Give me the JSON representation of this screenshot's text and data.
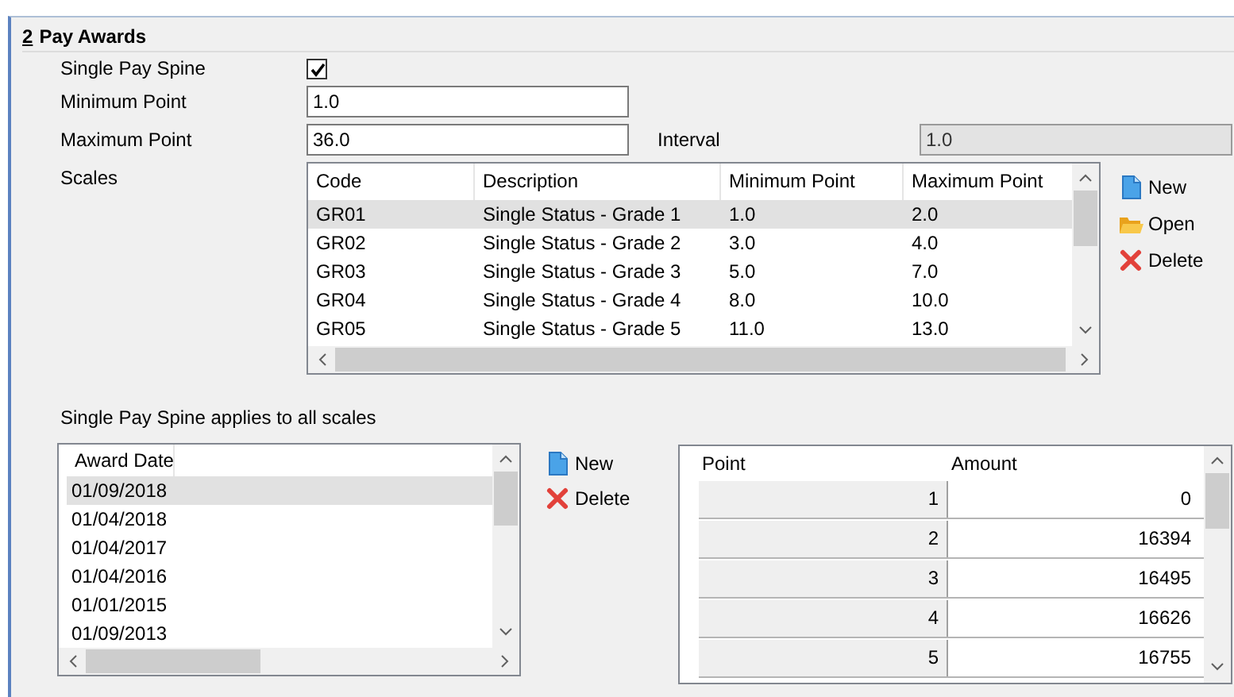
{
  "section": {
    "number": "2",
    "title": "Pay Awards"
  },
  "fields": [
    {
      "kind": "checkbox",
      "label": "Single Pay Spine",
      "checked": true
    },
    {
      "kind": "text",
      "label": "Minimum Point",
      "value": "1.0"
    },
    {
      "kind": "text",
      "label": "Maximum Point",
      "value": "36.0",
      "side": {
        "label": "Interval",
        "value": "1.0",
        "disabled": true
      }
    }
  ],
  "scales": {
    "label": "Scales",
    "columns": [
      "Code",
      "Description",
      "Minimum Point",
      "Maximum Point"
    ],
    "rows": [
      {
        "cells": [
          "GR01",
          "Single Status - Grade 1",
          "1.0",
          "2.0"
        ],
        "selected": true
      },
      {
        "cells": [
          "GR02",
          "Single Status - Grade 2",
          "3.0",
          "4.0"
        ],
        "selected": false
      },
      {
        "cells": [
          "GR03",
          "Single Status - Grade 3",
          "5.0",
          "7.0"
        ],
        "selected": false
      },
      {
        "cells": [
          "GR04",
          "Single Status - Grade 4",
          "8.0",
          "10.0"
        ],
        "selected": false
      },
      {
        "cells": [
          "GR05",
          "Single Status - Grade 5",
          "11.0",
          "13.0"
        ],
        "selected": false
      }
    ]
  },
  "scale_actions": [
    {
      "kind": "new",
      "label": "New"
    },
    {
      "kind": "open",
      "label": "Open"
    },
    {
      "kind": "delete",
      "label": "Delete"
    }
  ],
  "spine_note": "Single Pay Spine applies to all scales",
  "award_dates": {
    "column": "Award Date",
    "rows": [
      {
        "date": "01/09/2018",
        "selected": true
      },
      {
        "date": "01/04/2018",
        "selected": false
      },
      {
        "date": "01/04/2017",
        "selected": false
      },
      {
        "date": "01/04/2016",
        "selected": false
      },
      {
        "date": "01/01/2015",
        "selected": false
      },
      {
        "date": "01/09/2013",
        "selected": false
      }
    ]
  },
  "award_actions": [
    {
      "kind": "new",
      "label": "New"
    },
    {
      "kind": "delete",
      "label": "Delete"
    }
  ],
  "points": {
    "columns": [
      "Point",
      "Amount"
    ],
    "rows": [
      {
        "point": "1",
        "amount": "0"
      },
      {
        "point": "2",
        "amount": "16394"
      },
      {
        "point": "3",
        "amount": "16495"
      },
      {
        "point": "4",
        "amount": "16626"
      },
      {
        "point": "5",
        "amount": "16755"
      }
    ]
  }
}
